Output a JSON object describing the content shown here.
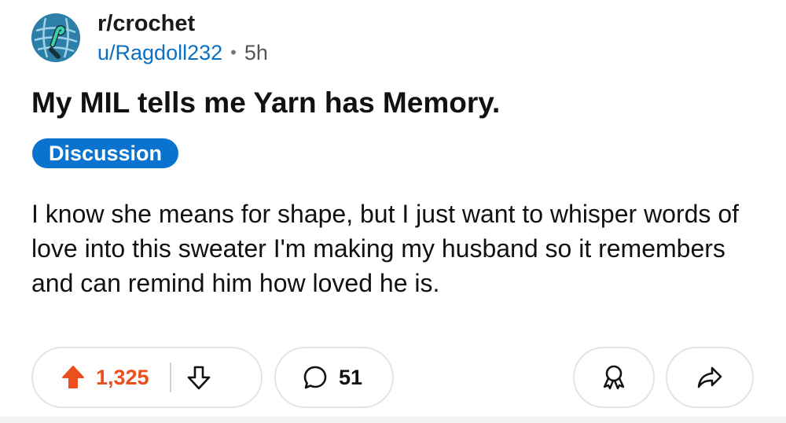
{
  "post": {
    "subreddit": "r/crochet",
    "username": "u/Ragdoll232",
    "separator": "•",
    "age": "5h",
    "title": "My MIL tells me Yarn has Memory.",
    "flair": "Discussion",
    "body": "I know she means for shape, but I just want to whisper words of love into this sweater I'm making my husband so it remembers and can remind him how loved he is."
  },
  "actions": {
    "upvotes": "1,325",
    "comments": "51",
    "upvote_icon": "upvote-arrow-icon",
    "downvote_icon": "downvote-arrow-icon",
    "comment_icon": "speech-bubble-icon",
    "award_icon": "award-ribbon-icon",
    "share_icon": "share-arrow-icon"
  },
  "colors": {
    "upvote": "#ea4f1c",
    "flair_bg": "#0a73d0",
    "username": "#0b6fc2",
    "avatar_bg": "#2d7fa8"
  }
}
